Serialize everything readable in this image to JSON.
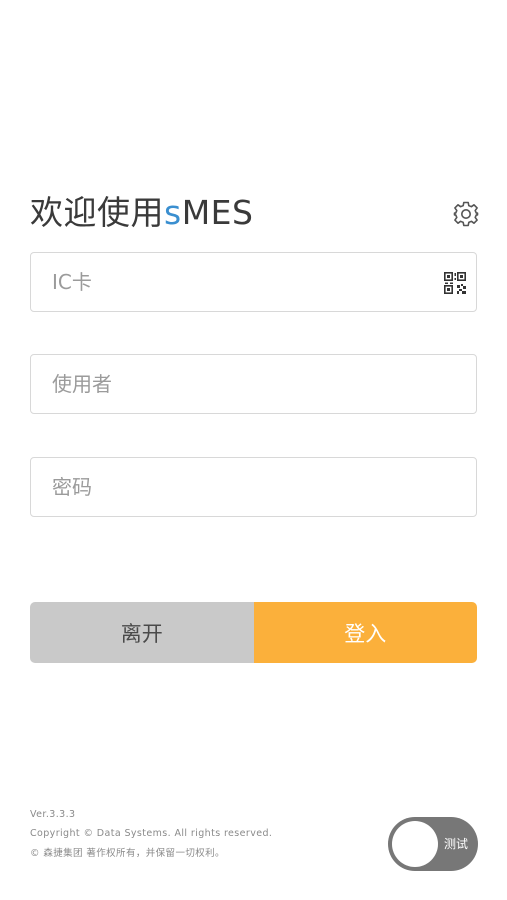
{
  "header": {
    "title_prefix": "欢迎使用",
    "title_accent": "s",
    "title_suffix": "MES",
    "settings_icon": "gear-icon"
  },
  "form": {
    "ic_card": {
      "value": "",
      "placeholder": "IC卡",
      "icon": "qr-code-icon"
    },
    "username": {
      "value": "",
      "placeholder": "使用者"
    },
    "password": {
      "value": "",
      "placeholder": "密码"
    }
  },
  "buttons": {
    "leave_label": "离开",
    "login_label": "登入"
  },
  "footer": {
    "version": "Ver.3.3.3",
    "copyright": "Copyright © Data Systems. All rights reserved.",
    "rights": "© 森捷集团 著作权所有，并保留一切权利。"
  },
  "toggle": {
    "label": "测试",
    "on": false
  },
  "colors": {
    "accent": "#3a8fd0",
    "login_button": "#fbb03b",
    "leave_button": "#c9c9c9",
    "toggle_track": "#777777"
  }
}
